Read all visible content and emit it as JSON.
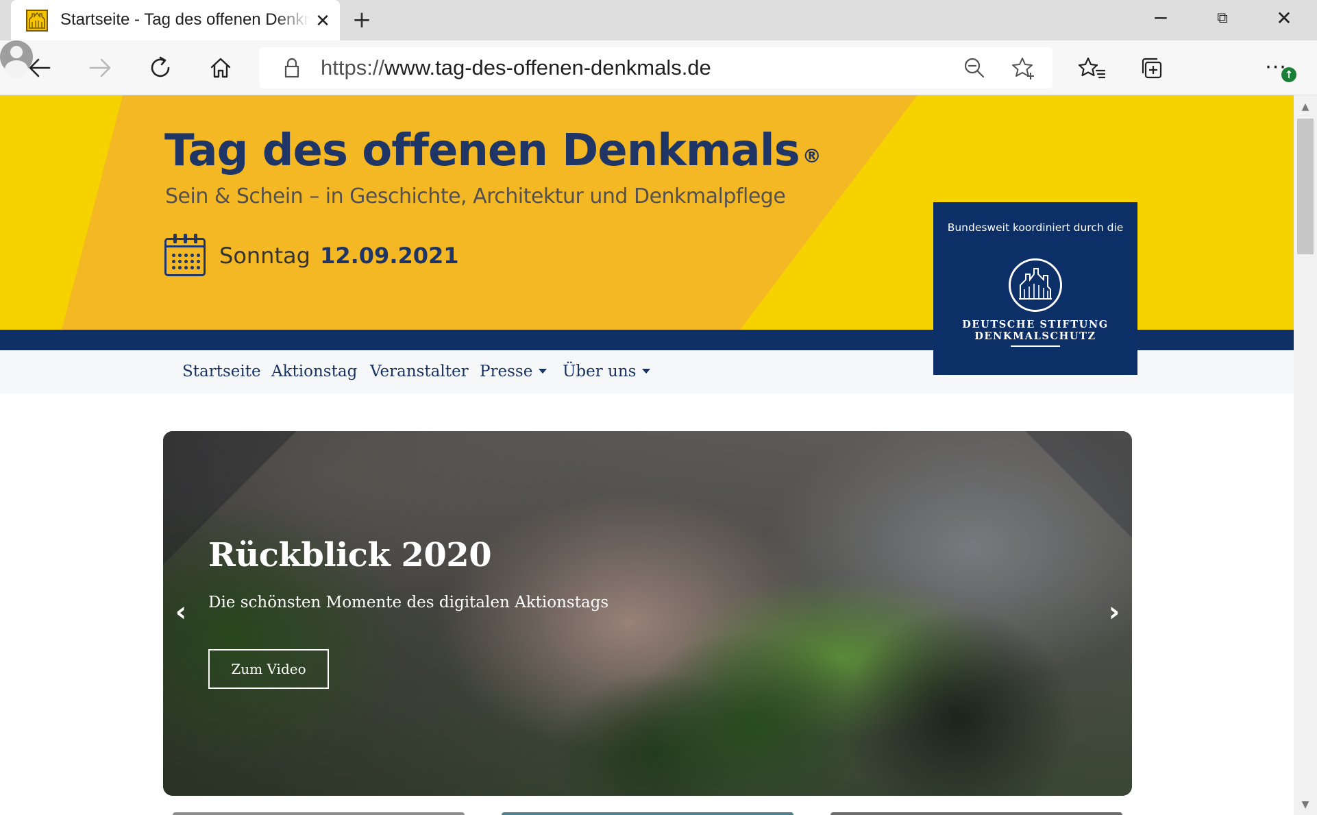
{
  "browser": {
    "tab": {
      "title": "Startseite - Tag des offenen Denkmals",
      "favicon": "site-favicon"
    },
    "new_tab_glyph": "+",
    "window_controls": {
      "minimize": "─",
      "maximize": "⧉",
      "close": "✕"
    },
    "address": {
      "scheme": "https://",
      "host": "www.tag-des-offenen-denkmals.de"
    },
    "icons": [
      "back-icon",
      "forward-icon",
      "refresh-icon",
      "home-icon",
      "lock-icon",
      "zoom-out-icon",
      "add-favorite-icon",
      "favorites-icon",
      "collections-icon",
      "profile-icon",
      "more-icon",
      "update-badge-icon"
    ]
  },
  "banner": {
    "title": "Tag des offenen Denkmals",
    "registered_mark": "®",
    "subtitle": "Sein & Schein – in Geschichte, Architektur und Denkmalpflege",
    "date_prefix": "Sonntag",
    "date": "12.09.2021",
    "colors": {
      "yellow": "#f7c928",
      "orange": "#f4b825",
      "navy": "#0f3064",
      "title": "#1f3566"
    }
  },
  "partner": {
    "caption": "Bundesweit koordiniert durch die",
    "name_line1": "DEUTSCHE STIFTUNG",
    "name_line2": "DENKMALSCHUTZ"
  },
  "nav": {
    "items": [
      {
        "label": "Startseite",
        "dropdown": false
      },
      {
        "label": "Aktionstag",
        "dropdown": false
      },
      {
        "label": "Veranstalter",
        "dropdown": false
      },
      {
        "label": "Presse",
        "dropdown": true
      },
      {
        "label": "Über uns",
        "dropdown": true
      }
    ]
  },
  "carousel": {
    "title": "Rückblick 2020",
    "text": "Die schönsten Momente des digitalen Aktionstags",
    "button": "Zum Video",
    "prev_glyph": "‹",
    "next_glyph": "›"
  }
}
